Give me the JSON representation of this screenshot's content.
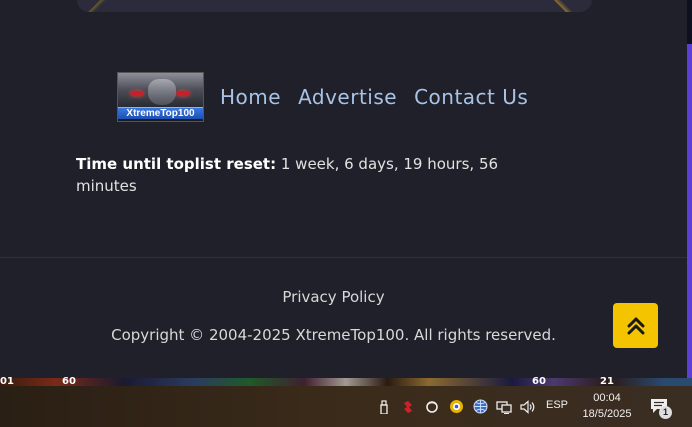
{
  "logo": {
    "text": "XtremeTop100"
  },
  "nav": {
    "items": [
      "Home",
      "Advertise",
      "Contact Us"
    ]
  },
  "reset": {
    "label": "Time until toplist reset:",
    "value": " 1 week, 6 days, 19 hours, 56 minutes"
  },
  "footer": {
    "privacy": "Privacy Policy",
    "copyright": "Copyright © 2004-2025 XtremeTop100. All rights reserved."
  },
  "game_strip": {
    "labels": [
      "01",
      "60",
      "60",
      "21"
    ]
  },
  "taskbar": {
    "language": "ESP",
    "time": "00:04",
    "date": "18/5/2025",
    "notification_count": "1",
    "tray_icons": [
      "usb-drive-icon",
      "red-app-icon",
      "circle-app-icon",
      "yellow-app-icon",
      "globe-icon",
      "network-monitor-icon",
      "volume-icon"
    ]
  },
  "colors": {
    "accent": "#5b3fd6",
    "button": "#f5c400",
    "nav_link": "#a9c3e6",
    "background": "#1f2029"
  }
}
